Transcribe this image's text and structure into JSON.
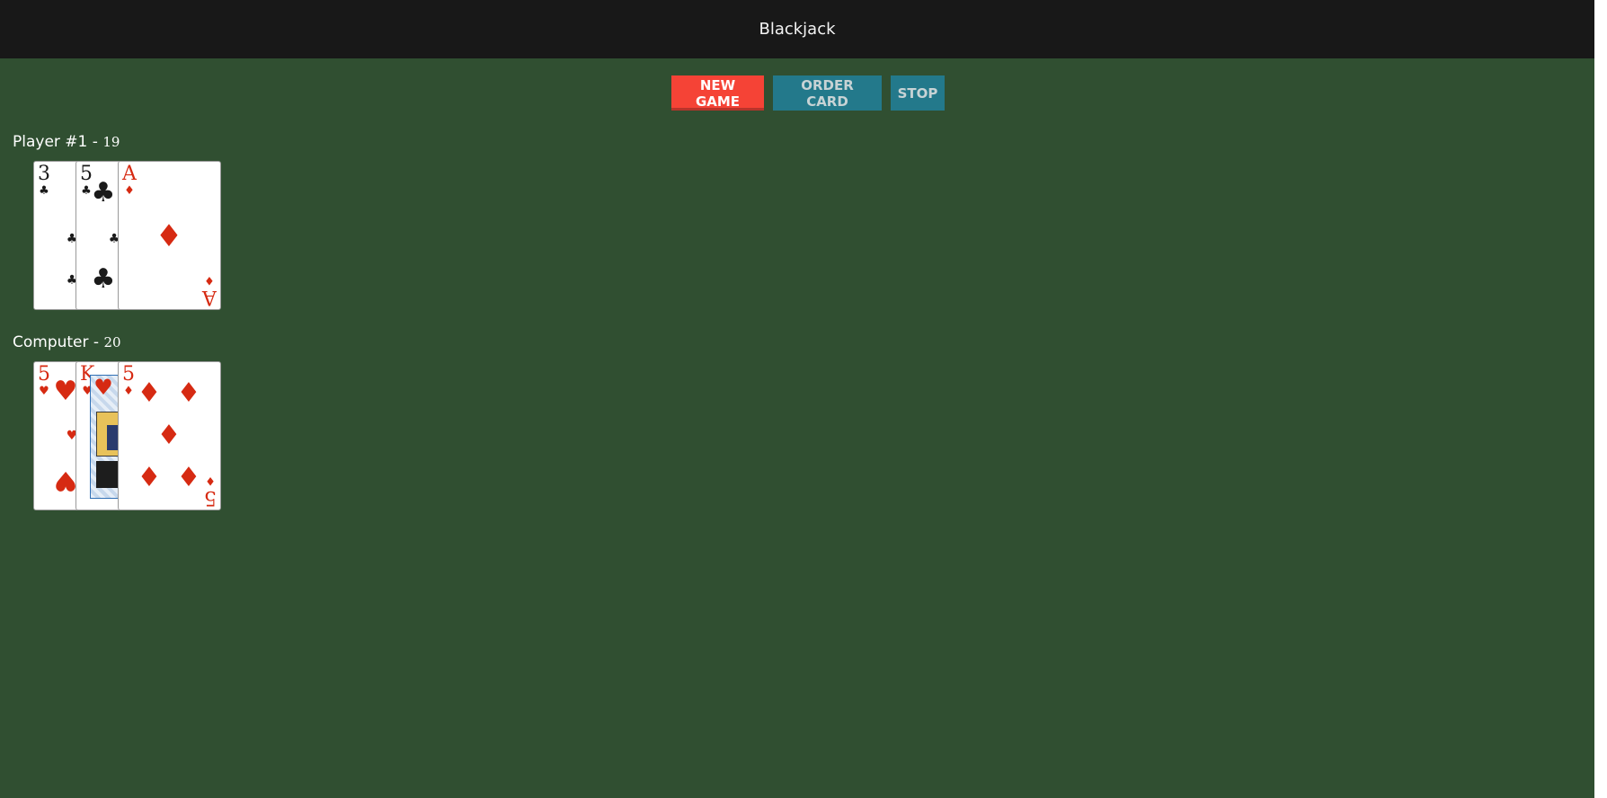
{
  "header": {
    "title": "Blackjack"
  },
  "controls": {
    "new_game": "NEW GAME",
    "order_card": "ORDER CARD",
    "stop": "STOP"
  },
  "player": {
    "name": "Player #1 - ",
    "score": "19",
    "cards": [
      {
        "rank": "3",
        "suit": "♣",
        "color": "black"
      },
      {
        "rank": "5",
        "suit": "♣",
        "color": "black"
      },
      {
        "rank": "A",
        "suit": "♦",
        "color": "red"
      }
    ]
  },
  "computer": {
    "name": "Computer - ",
    "score": "20",
    "cards": [
      {
        "rank": "5",
        "suit": "♥",
        "color": "red"
      },
      {
        "rank": "K",
        "suit": "♥",
        "color": "red"
      },
      {
        "rank": "5",
        "suit": "♦",
        "color": "red"
      }
    ]
  },
  "colors": {
    "table": "#304f31",
    "header": "#181818",
    "new_game": "#f54336",
    "action": "#23798b",
    "red_suit": "#d62a12"
  }
}
